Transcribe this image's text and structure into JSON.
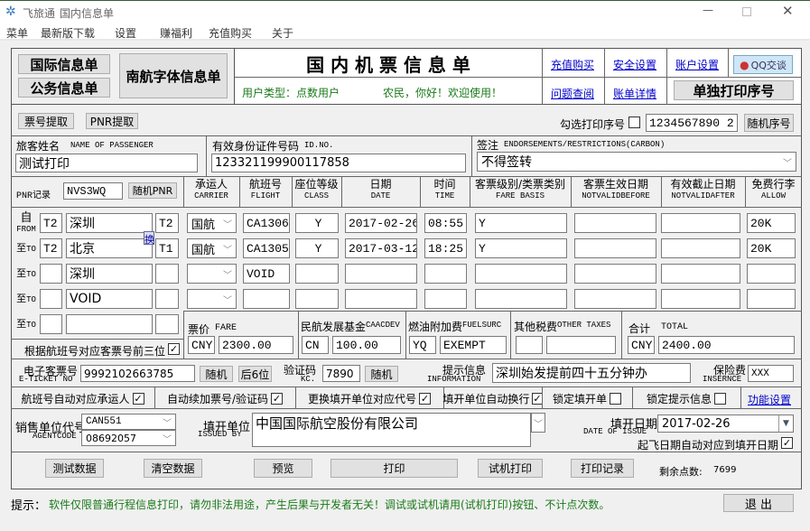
{
  "window": {
    "app": "飞旅通",
    "title": "国内信息单"
  },
  "menu": [
    "菜单",
    "最新版下载",
    "设置",
    "赚福利",
    "充值购买",
    "关于"
  ],
  "header": {
    "intl_btn": "国际信息单",
    "official_btn": "公务信息单",
    "southern_btn": "南航字体信息单",
    "title": "国 内 机 票 信 息 单",
    "user_type": "用户类型：点数用户",
    "greeting": "农民，你好！欢迎使用！",
    "links": [
      "充值购买",
      "安全设置",
      "账户设置",
      "问题查阅",
      "账单详情"
    ],
    "qq_btn": "QQ交谈",
    "print_seq_btn": "单独打印序号"
  },
  "toolbar": {
    "ticket_fetch": "票号提取",
    "pnr_fetch": "PNR提取",
    "check_seq_label": "勾选打印序号",
    "seq_value": "1234567890 2",
    "random_seq": "随机序号"
  },
  "passenger": {
    "name_label": "旅客姓名",
    "name_label_en": "NAME OF PASSENGER",
    "name": "测试打印",
    "id_label": "有效身份证件号码",
    "id_label_en": "ID.NO.",
    "id": "123321199900117858",
    "endorse_label": "签注",
    "endorse_label_en": "ENDORSEMENTS/RESTRICTIONS(CARBON)",
    "endorse": "不得签转"
  },
  "pnr": {
    "label": "PNR记录",
    "value": "NVS3WQ",
    "random": "随机PNR"
  },
  "columns": [
    {
      "cn": "承运人",
      "en": "CARRIER"
    },
    {
      "cn": "航班号",
      "en": "FLIGHT"
    },
    {
      "cn": "座位等级",
      "en": "CLASS"
    },
    {
      "cn": "日期",
      "en": "DATE"
    },
    {
      "cn": "时间",
      "en": "TIME"
    },
    {
      "cn": "客票级别/类票类别",
      "en": "FARE BASIS"
    },
    {
      "cn": "客票生效日期",
      "en": "NOTVALIDBEFORE"
    },
    {
      "cn": "有效截止日期",
      "en": "NOTVALIDAFTER"
    },
    {
      "cn": "免费行李",
      "en": "ALLOW"
    }
  ],
  "swap": "换",
  "segments": [
    {
      "label": "自",
      "label_en": "FROM",
      "t1": "T2",
      "city": "深圳",
      "t2": "T2",
      "carrier": "国航",
      "flight": "CA1306",
      "class": "Y",
      "date": "2017-02-26",
      "time": "08:55",
      "fare": "Y",
      "nvb": "",
      "nva": "",
      "allow": "20K"
    },
    {
      "label": "至",
      "label_en": "TO",
      "t1": "T2",
      "city": "北京",
      "t2": "T1",
      "carrier": "国航",
      "flight": "CA1305",
      "class": "Y",
      "date": "2017-03-12",
      "time": "18:25",
      "fare": "Y",
      "nvb": "",
      "nva": "",
      "allow": "20K"
    },
    {
      "label": "至",
      "label_en": "TO",
      "t1": "",
      "city": "深圳",
      "t2": "",
      "carrier": "",
      "flight": "VOID",
      "class": "",
      "date": "",
      "time": "",
      "fare": "",
      "nvb": "",
      "nva": "",
      "allow": ""
    },
    {
      "label": "至",
      "label_en": "TO",
      "t1": "",
      "city": "VOID",
      "t2": "",
      "carrier": "",
      "flight": "",
      "class": "",
      "date": "",
      "time": "",
      "fare": "",
      "nvb": "",
      "nva": "",
      "allow": ""
    },
    {
      "label": "至",
      "label_en": "TO",
      "t1": "",
      "city": "",
      "t2": ""
    }
  ],
  "prefix_check": "根据航班号对应客票号前三位",
  "fares": {
    "fare_label": "票价",
    "fare_label_en": "FARE",
    "fare_cur": "CNY",
    "fare": "2300.00",
    "caac_label": "民航发展基金",
    "caac_label_en": "CAACDEV",
    "caac_cur": "CN",
    "caac": "100.00",
    "fuel_label": "燃油附加费",
    "fuel_label_en": "FUELSURC",
    "fuel_cur": "YQ",
    "fuel": "EXEMPT",
    "other_label": "其他税费",
    "other_label_en": "OTHER TAXES",
    "other_cur": "",
    "other": "",
    "total_label": "合计",
    "total_label_en": "TOTAL",
    "total_cur": "CNY",
    "total": "2400.00"
  },
  "eticket": {
    "label": "电子客票号",
    "label_en": "E-TICKET NO",
    "value": "9992102663785",
    "random": "随机",
    "last6": "后6位",
    "vc_label": "验证码",
    "vc_label_en": "KC.",
    "vc": "7890",
    "vc_random": "随机",
    "info_label": "提示信息",
    "info_label_en": "INFORMATION",
    "info": "深圳始发提前四十五分钟办",
    "ins_label": "保险费",
    "ins_label_en": "INSERNCE",
    "ins": "XXX"
  },
  "options": [
    {
      "label": "航班号自动对应承运人",
      "checked": true
    },
    {
      "label": "自动续加票号/验证码",
      "checked": true
    },
    {
      "label": "更换填开单位对应代号",
      "checked": true
    },
    {
      "label": "填开单位自动换行",
      "checked": true
    },
    {
      "label": "锁定填开单",
      "checked": false
    },
    {
      "label": "锁定提示信息",
      "checked": false
    }
  ],
  "func_settings": "功能设置",
  "agent": {
    "label": "销售单位代号",
    "label_en": "AGENTCODE",
    "code1": "CAN551",
    "code2": "08692057",
    "issued_label": "填开单位",
    "issued_label_en": "ISSUED BY",
    "issued": "中国国际航空股份有限公司",
    "date_label": "填开日期",
    "date_label_en": "DATE OF ISSUE",
    "date": "2017-02-26",
    "auto_date": "起飞日期自动对应到填开日期",
    "auto_date_checked": true
  },
  "actions": {
    "test": "测试数据",
    "clear": "清空数据",
    "preview": "预览",
    "print": "打印",
    "trial": "试机打印",
    "log": "打印记录",
    "points_label": "剩余点数:",
    "points": "7699"
  },
  "footer": {
    "tip_label": "提示：",
    "tip": "软件仅限普通行程信息打印，请勿非法用途，产生后果与开发者无关！调试或试机请用(试机打印)按钮、不计点次数。",
    "exit": "退 出"
  }
}
